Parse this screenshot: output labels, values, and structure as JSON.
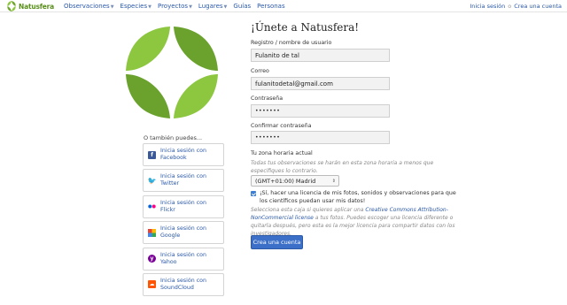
{
  "brand": {
    "name": "Natusfera"
  },
  "nav": {
    "items": [
      {
        "label": "Observaciones",
        "has_caret": true
      },
      {
        "label": "Especies",
        "has_caret": true
      },
      {
        "label": "Proyectos",
        "has_caret": true
      },
      {
        "label": "Lugares",
        "has_caret": true
      },
      {
        "label": "Guías",
        "has_caret": false
      },
      {
        "label": "Personas",
        "has_caret": false
      }
    ],
    "login_link": "Inicia sesión",
    "separator": "o",
    "signup_link": "Crea una cuenta"
  },
  "left": {
    "also_label": "O también puedes...",
    "social_buttons": [
      {
        "line1": "Inicia sesión con",
        "line2": "Facebook",
        "icon": "facebook-icon",
        "color": "#3b5998",
        "glyph": "f"
      },
      {
        "line1": "Inicia sesión con",
        "line2": "Twitter",
        "icon": "twitter-icon",
        "color": "#55acee",
        "glyph": "t"
      },
      {
        "line1": "Inicia sesión con",
        "line2": "Flickr",
        "icon": "flickr-icon",
        "color": "#ffffff",
        "glyph": ""
      },
      {
        "line1": "Inicia sesión con",
        "line2": "Google",
        "icon": "google-icon",
        "color": "#ffffff",
        "glyph": ""
      },
      {
        "line1": "Inicia sesión con",
        "line2": "Yahoo",
        "icon": "yahoo-icon",
        "color": "#7b0099",
        "glyph": "y"
      },
      {
        "line1": "Inicia sesión con",
        "line2": "SoundCloud",
        "icon": "soundcloud-icon",
        "color": "#f50",
        "glyph": "s"
      }
    ]
  },
  "form": {
    "title": "¡Únete a Natusfera!",
    "username_label": "Registro / nombre de usuario",
    "username_value": "Fulanito de tal",
    "email_label": "Correo",
    "email_value": "fulanitodetal@gmail.com",
    "password_label": "Contraseña",
    "password_value": "•••••••",
    "confirm_label": "Confirmar contraseña",
    "confirm_value": "•••••••",
    "timezone_label": "Tu zona horaria actual",
    "timezone_hint": "Todas tus observaciones se harán en esta zona horaria a menos que especifiques lo contrario.",
    "timezone_value": "(GMT+01:00) Madrid",
    "license_checked": true,
    "license_label": "¡Sí, hacer una licencia de mis fotos, sonidos y observaciones para que los científicos puedan usar mis datos!",
    "license_hint_pre": "Selecciona esta caja si quieres aplicar una ",
    "license_hint_link": "Creative Commons Attribution-NonCommercial license",
    "license_hint_post": " a tus fotos. Puedes escoger una licencia diferente o quitarla después, pero esta es la mejor licencia para compartir datos con los investigadores.",
    "submit_label": "Crea una cuenta"
  },
  "colors": {
    "brand_green": "#8dc63f",
    "link_blue": "#2a58a8",
    "button_blue": "#3b6fc8"
  }
}
